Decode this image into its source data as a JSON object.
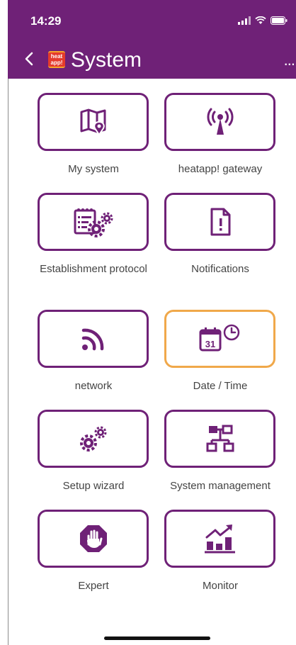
{
  "status_bar": {
    "time": "14:29"
  },
  "nav": {
    "title": "System",
    "logo_text": "heat app!",
    "more_label": "..."
  },
  "tiles": [
    {
      "label": "My system",
      "icon": "map-location-icon"
    },
    {
      "label": "heatapp! gateway",
      "icon": "antenna-icon"
    },
    {
      "label": "Establishment protocol",
      "icon": "protocol-gears-icon"
    },
    {
      "label": "Notifications",
      "icon": "notification-document-icon"
    },
    {
      "label": "network",
      "icon": "wireless-signal-icon"
    },
    {
      "label": "Date / Time",
      "icon": "calendar-clock-icon",
      "selected": true
    },
    {
      "label": "Setup wizard",
      "icon": "gears-icon"
    },
    {
      "label": "System management",
      "icon": "hierarchy-icon"
    },
    {
      "label": "Expert",
      "icon": "hand-stop-icon"
    },
    {
      "label": "Monitor",
      "icon": "bar-chart-trend-icon"
    }
  ],
  "colors": {
    "brand": "#6f2177",
    "selected_border": "#f0a84a",
    "text": "#444444"
  }
}
